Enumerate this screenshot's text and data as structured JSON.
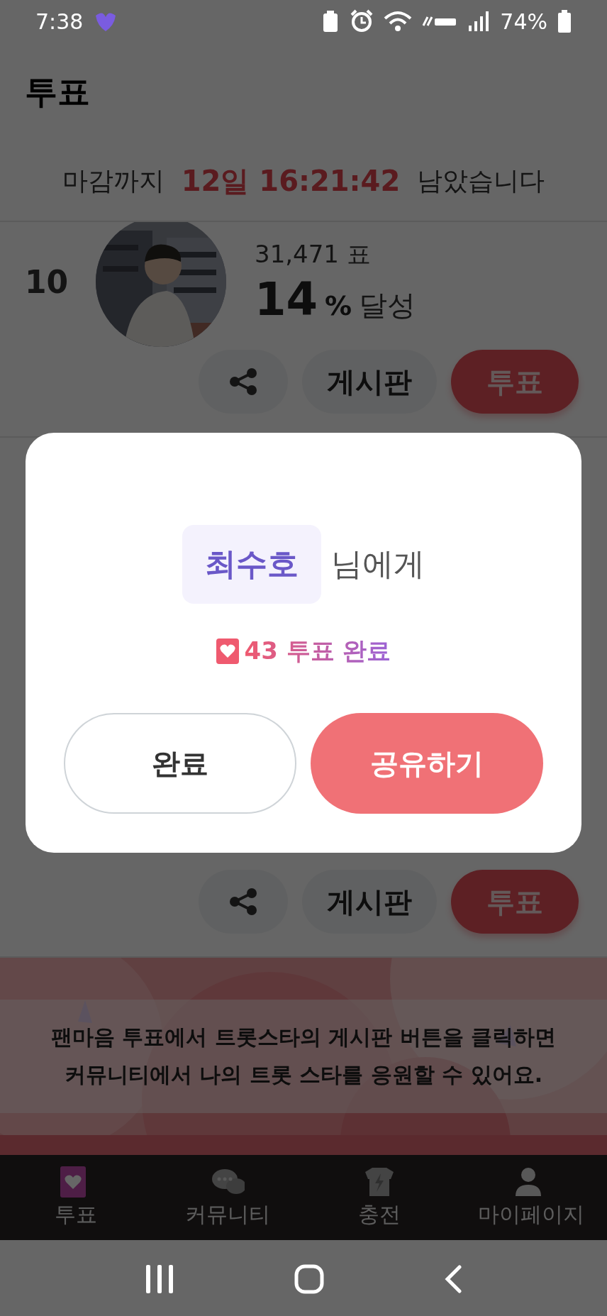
{
  "status_bar": {
    "time": "7:38",
    "battery": "74%"
  },
  "header": {
    "title": "투표"
  },
  "countdown": {
    "prefix": "마감까지",
    "remaining": "12일 16:21:42",
    "suffix": "남았습니다"
  },
  "candidates": [
    {
      "rank": "10",
      "votes": "31,471 표",
      "percent": "14",
      "percent_unit": "%",
      "achieved": "달성",
      "board_button": "게시판",
      "vote_button": "투표"
    },
    {
      "board_button": "게시판",
      "vote_button": "투표"
    }
  ],
  "banner": {
    "lines": [
      "팬마음 투표에서 트롯스타의 게시판 버튼을 클릭하면",
      "커뮤니티에서 나의 트롯 스타를 응원할 수 있어요."
    ]
  },
  "bottom_nav": [
    {
      "label": "투표",
      "kind": "vote",
      "selected": true
    },
    {
      "label": "커뮤니티",
      "kind": "community",
      "selected": false
    },
    {
      "label": "충전",
      "kind": "charge",
      "selected": false
    },
    {
      "label": "마이페이지",
      "kind": "mypage",
      "selected": false
    }
  ],
  "modal": {
    "recipient": "최수호",
    "recipient_suffix": "님에게",
    "result": "43 투표 완료",
    "buttons": [
      {
        "label": "완료",
        "kind": "outline"
      },
      {
        "label": "공유하기",
        "kind": "filled"
      }
    ]
  }
}
